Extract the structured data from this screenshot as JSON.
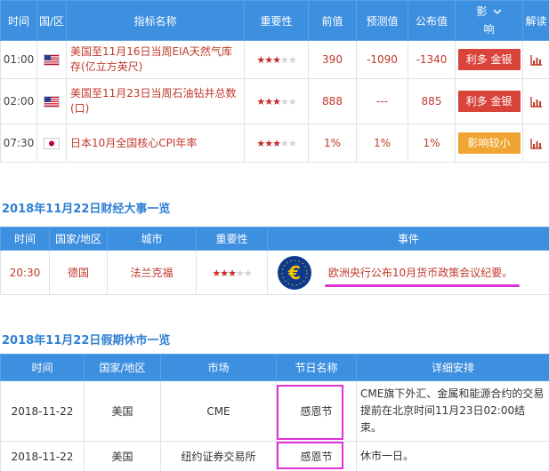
{
  "indicators": {
    "headers": {
      "time": "时间",
      "country": "国/区",
      "name": "指标名称",
      "importance": "重要性",
      "previous": "前值",
      "forecast": "预测值",
      "actual": "公布值",
      "impact_top": "影",
      "impact_bottom": "响",
      "analysis": "解读"
    },
    "rows": [
      {
        "time": "01:00",
        "flag": "us-flag-icon",
        "name": "美国至11月16日当周EIA天然气库存(亿立方英尺)",
        "stars": 3,
        "previous": "390",
        "forecast": "-1090",
        "actual": "-1340",
        "impact": "利多 金银",
        "impact_color": "#d9443a"
      },
      {
        "time": "02:00",
        "flag": "us-flag-icon",
        "name": "美国至11月23日当周石油钻井总数(口)",
        "stars": 3,
        "previous": "888",
        "forecast": "---",
        "actual": "885",
        "impact": "利多 金银",
        "impact_color": "#d9443a"
      },
      {
        "time": "07:30",
        "flag": "japan-flag-icon",
        "name": "日本10月全国核心CPI年率",
        "stars": 3,
        "previous": "1%",
        "forecast": "1%",
        "actual": "1%",
        "impact": "影响较小",
        "impact_color": "#f0a431"
      }
    ]
  },
  "events_section": {
    "title": "2018年11月22日财经大事一览",
    "headers": {
      "time": "时间",
      "country": "国家/地区",
      "city": "城市",
      "importance": "重要性",
      "event": "事件"
    },
    "rows": [
      {
        "time": "20:30",
        "country": "德国",
        "city": "法兰克福",
        "stars": 3,
        "logo": "ecb-euro-logo-icon",
        "event": "欧洲央行公布10月货币政策会议纪要。"
      }
    ]
  },
  "holidays_section": {
    "title": "2018年11月22日假期休市一览",
    "headers": {
      "time": "时间",
      "country": "国家/地区",
      "market": "市场",
      "holiday": "节日名称",
      "detail": "详细安排"
    },
    "rows": [
      {
        "time": "2018-11-22",
        "country": "美国",
        "market": "CME",
        "holiday": "感恩节",
        "detail": "CME旗下外汇、金属和能源合约的交易提前在北京时间11月23日02:00结束。"
      },
      {
        "time": "2018-11-22",
        "country": "美国",
        "market": "纽约证券交易所",
        "holiday": "感恩节",
        "detail": "休市一日。"
      }
    ]
  },
  "colors": {
    "header_blue": "#3d8fe0",
    "title_blue": "#2f7fd3",
    "value_red": "#c0392b",
    "highlight_magenta": "#e033d6"
  }
}
